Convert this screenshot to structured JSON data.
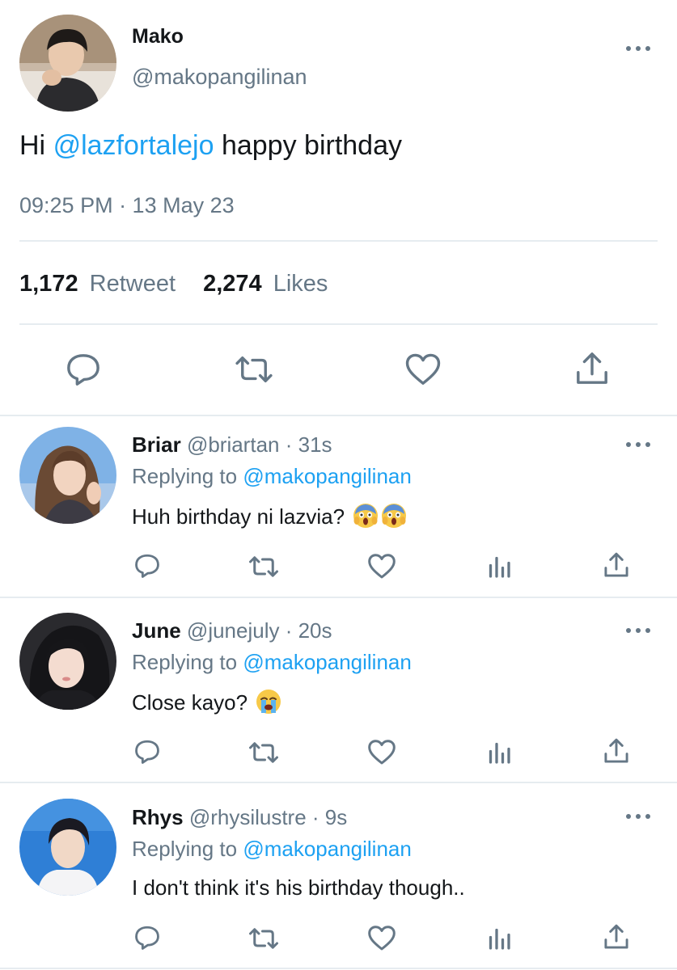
{
  "tweet": {
    "author_name": "Mako",
    "author_handle": "@makopangilinan",
    "text_before": "Hi ",
    "mention": "@lazfortalejo",
    "text_after": " happy birthday",
    "timestamp": "09:25 PM · 13 May 23",
    "retweet_count": "1,172",
    "retweet_label": "Retweet",
    "likes_count": "2,274",
    "likes_label": "Likes"
  },
  "replies": [
    {
      "name": "Briar",
      "handle": "@briartan",
      "time": "31s",
      "replying_label": "Replying to",
      "replying_handle": "@makopangilinan",
      "text": "Huh birthday ni lazvia?",
      "emojis": [
        "screaming-face-icon",
        "screaming-face-icon"
      ]
    },
    {
      "name": "June",
      "handle": "@junejuly",
      "time": "20s",
      "replying_label": "Replying to",
      "replying_handle": "@makopangilinan",
      "text": "Close kayo?",
      "emojis": [
        "crying-face-icon"
      ]
    },
    {
      "name": "Rhys",
      "handle": "@rhysilustre",
      "time": "9s",
      "replying_label": "Replying to",
      "replying_handle": "@makopangilinan",
      "text": "I don't think it's his birthday though..",
      "emojis": []
    }
  ],
  "colors": {
    "link": "#1da1f2",
    "muted": "#657786",
    "text": "#14171a",
    "divider": "#e6ecf0"
  },
  "icons": {
    "reply": "reply-icon",
    "retweet": "retweet-icon",
    "like": "heart-icon",
    "share": "share-icon",
    "analytics": "analytics-icon",
    "more": "more-icon"
  }
}
